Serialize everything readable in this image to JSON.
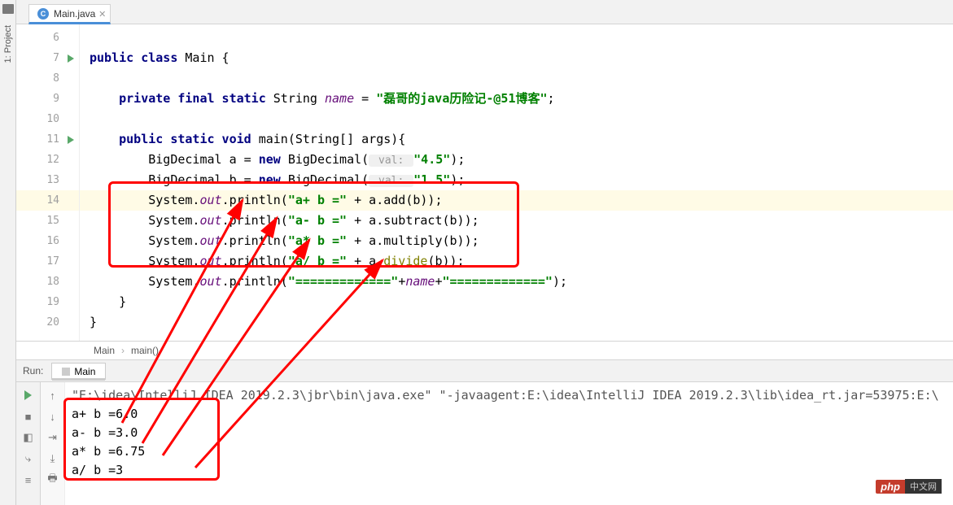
{
  "tabs": {
    "file": "Main.java"
  },
  "sidebar": {
    "label": "1: Project"
  },
  "gutter": {
    "lines": [
      "6",
      "7",
      "8",
      "9",
      "10",
      "11",
      "12",
      "13",
      "14",
      "15",
      "16",
      "17",
      "18",
      "19",
      "20"
    ],
    "runMarkers": [
      7,
      11
    ],
    "highlighted": 14
  },
  "code": {
    "l6": "",
    "l7_pre": "public class ",
    "l7_name": "Main {",
    "l9_pre": "    private final static ",
    "l9_type": "String ",
    "l9_var": "name",
    "l9_eq": " = ",
    "l9_str": "\"磊哥的java历险记-@51博客\"",
    "l9_end": ";",
    "l11_pre": "    public static void ",
    "l11_sig": "main(String[] args){",
    "l12_a": "        BigDecimal a = ",
    "l12_new": "new ",
    "l12_b": "BigDecimal(",
    "l12_hint": " val: ",
    "l12_str": "\"4.5\"",
    "l12_end": ");",
    "l13_a": "        BigDecimal b = ",
    "l13_new": "new ",
    "l13_b": "BigDecimal(",
    "l13_hint": " val: ",
    "l13_str": "\"1.5\"",
    "l13_end": ");",
    "l14_a": "        System.",
    "l14_out": "out",
    "l14_b": ".println(",
    "l14_str": "\"a+ b =\"",
    "l14_c": " + a.add(b));",
    "l15_a": "        System.",
    "l15_out": "out",
    "l15_b": ".println(",
    "l15_str": "\"a- b =\"",
    "l15_c": " + a.subtract(b));",
    "l16_a": "        System.",
    "l16_out": "out",
    "l16_b": ".println(",
    "l16_str": "\"a* b =\"",
    "l16_c": " + a.multiply(b));",
    "l17_a": "        System.",
    "l17_out": "out",
    "l17_b": ".println(",
    "l17_str": "\"a/ b =\"",
    "l17_c": " + a.",
    "l17_div": "divide",
    "l17_d": "(b));",
    "l18_a": "        System.",
    "l18_out": "out",
    "l18_b": ".println(",
    "l18_str1": "\"=============\"",
    "l18_p1": "+",
    "l18_name": "name",
    "l18_p2": "+",
    "l18_str2": "\"=============\"",
    "l18_end": ");",
    "l19": "    }",
    "l20": "}"
  },
  "breadcrumb": {
    "a": "Main",
    "b": "main()"
  },
  "run": {
    "label": "Run:",
    "tabName": "Main",
    "command": "\"E:\\idea\\IntelliJ IDEA 2019.2.3\\jbr\\bin\\java.exe\" \"-javaagent:E:\\idea\\IntelliJ IDEA 2019.2.3\\lib\\idea_rt.jar=53975:E:\\",
    "out1": "a+ b =6.0",
    "out2": "a- b =3.0",
    "out3": "a* b =6.75",
    "out4": "a/ b =3"
  },
  "watermark": {
    "a": "php",
    "b": "中文网"
  }
}
